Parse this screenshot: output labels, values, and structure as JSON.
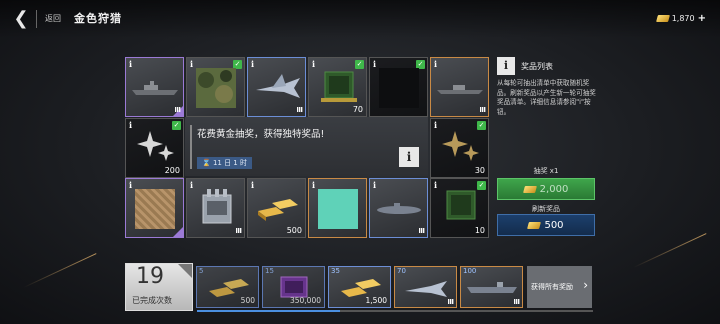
{
  "header": {
    "back_label": "返回",
    "title": "金色狩猎",
    "currency_value": "1,870",
    "plus_label": "+"
  },
  "grid": {
    "tiles": [
      {
        "name": "battleship",
        "info": "i",
        "badge": "Ⅲ"
      },
      {
        "name": "camo-paint",
        "info": "i",
        "check": "✓"
      },
      {
        "name": "jet-fighter",
        "info": "i",
        "badge": "Ⅲ"
      },
      {
        "name": "supply-crate",
        "info": "i",
        "check": "✓",
        "qty": "70"
      },
      {
        "name": "dark-paint",
        "info": "i",
        "check": "✓"
      },
      {
        "name": "destroyer",
        "info": "i",
        "badge": "Ⅲ"
      },
      {
        "name": "sparkle-silver",
        "info": "i",
        "check": "✓",
        "qty": "200"
      },
      {
        "name": "sparkle-gold",
        "info": "i",
        "check": "✓",
        "qty": "30"
      },
      {
        "name": "sand-paint",
        "info": "i"
      },
      {
        "name": "turret",
        "info": "i",
        "badge": "Ⅲ"
      },
      {
        "name": "gold-bars",
        "info": "i",
        "qty": "500"
      },
      {
        "name": "teal-paint",
        "info": "i"
      },
      {
        "name": "submarine",
        "info": "i",
        "badge": "Ⅲ"
      },
      {
        "name": "green-crate",
        "info": "i",
        "check": "✓",
        "qty": "10"
      }
    ]
  },
  "center": {
    "headline": "花费黄金抽奖，获得独特奖品!",
    "timer": "11 日 1 时",
    "info_btn": "i"
  },
  "side": {
    "title": "奖品列表",
    "desc": "从每轮可抽出清单中获取随机奖品。刷新奖品以产生新一轮可抽奖奖品清单。详细信息请参阅\"i\"按钮。",
    "info": "i"
  },
  "draw": {
    "label": "抽奖 x1",
    "price": "2,000"
  },
  "refresh": {
    "label": "刷新奖品",
    "price": "500"
  },
  "milestones": {
    "count": "19",
    "count_label": "已完成次数",
    "progress_fraction": 0.36,
    "items": [
      {
        "level": "5",
        "name": "gold-bars",
        "qty": "500"
      },
      {
        "level": "15",
        "name": "purple-box",
        "qty": "350,000"
      },
      {
        "level": "35",
        "name": "gold-bars",
        "qty": "1,500"
      },
      {
        "level": "70",
        "name": "jet-fighter",
        "tier": "Ⅲ"
      },
      {
        "level": "100",
        "name": "carrier",
        "tier": "Ⅲ"
      }
    ],
    "get_all": "获得所有奖励",
    "arrow": "›"
  },
  "colors": {
    "accent_blue": "#4b8fe0",
    "green": "#3fb84a",
    "gold": "#e7b84a"
  }
}
